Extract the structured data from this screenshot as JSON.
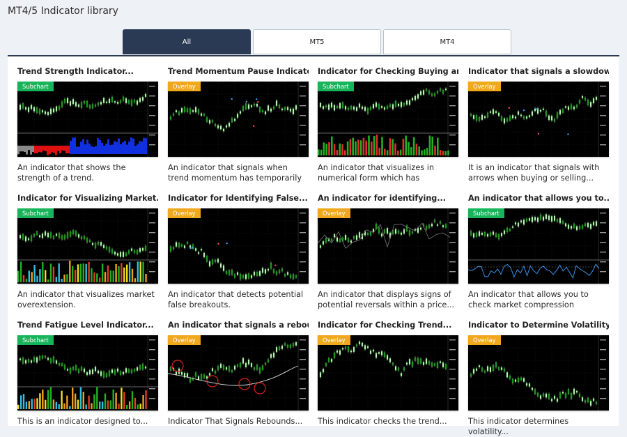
{
  "page": {
    "title": "MT4/5 Indicator library"
  },
  "tabs": [
    {
      "label": "All",
      "active": true
    },
    {
      "label": "MT5",
      "active": false
    },
    {
      "label": "MT4",
      "active": false
    }
  ],
  "cards": [
    {
      "title": "Trend Strength Indicator...",
      "badge": "Subchart",
      "description": "An indicator that shows the strength of a trend."
    },
    {
      "title": "Trend Momentum Pause Indicator...",
      "badge": "Overlay",
      "description": "An indicator that signals when trend momentum has temporarily paused."
    },
    {
      "title": "Indicator for Checking Buying and...",
      "badge": "Subchart",
      "description": "An indicator that visualizes in numerical form which has stronger..."
    },
    {
      "title": "Indicator that signals a slowdown ...",
      "badge": "Overlay",
      "description": "It is an indicator that signals with arrows when buying or selling..."
    },
    {
      "title": "Indicator for Visualizing Market...",
      "badge": "Subchart",
      "description": "An indicator that visualizes market overextension."
    },
    {
      "title": "Indicator for Identifying False...",
      "badge": "Overlay",
      "description": "An indicator that detects potential false breakouts."
    },
    {
      "title": "An indicator for identifying...",
      "badge": "Overlay",
      "description": "An indicator that displays signs of potential reversals within a price..."
    },
    {
      "title": "An indicator that allows you to...",
      "badge": "Subchart",
      "description": "An indicator that allows you to check market compression conditions in..."
    },
    {
      "title": "Trend Fatigue Level Indicator...",
      "badge": "Subchart",
      "description": "This is an indicator designed to..."
    },
    {
      "title": "An indicator that signals a reboun...",
      "badge": "Overlay",
      "description": "Indicator That Signals Rebounds..."
    },
    {
      "title": "Indicator for Checking Trend...",
      "badge": "Overlay",
      "description": "This indicator checks the trend..."
    },
    {
      "title": "Indicator to Determine Volatility...",
      "badge": "Overlay",
      "description": "This indicator determines volatility..."
    }
  ]
}
